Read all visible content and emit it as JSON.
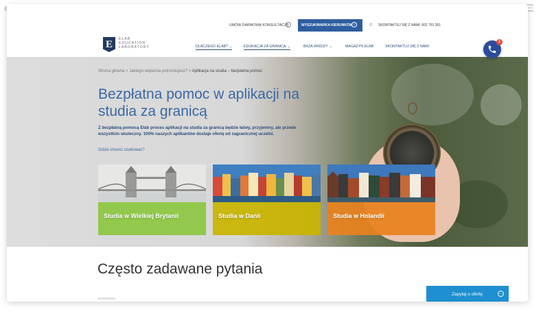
{
  "topbar": {
    "consult": "Umów darmową konsultację",
    "consult_icon": "chevron-right-circle-icon",
    "search_button": "Wyszukiwarka kierunków",
    "phone_label": "Skontaktuj się z nami: 602 751 351"
  },
  "logo": {
    "mark": "E",
    "line1": "ELAB",
    "line2": "EDUCATION",
    "line3": "LABORATORY"
  },
  "nav": {
    "why": "Dlaczego Elab?",
    "edu": "Edukacja za granicą",
    "knowledge": "Baza wiedzy",
    "magazine": "Magazyn Elab",
    "contact": "Skontaktuj się z nami",
    "chevron": "⌄"
  },
  "fab": {
    "badge": "1"
  },
  "breadcrumb": {
    "home": "Strona główna",
    "sep": ">",
    "parent": "Jakiego wsparcia potrzebujesz?",
    "current": "Aplikacja na studia – bezpłatna pomoc"
  },
  "hero": {
    "title": "Bezpłatna pomoc w aplikacji na studia za granicą",
    "description": "Z bezpłatną pomocą Elab proces aplikacji na studia za granicą będzie łatwy, przyjemny, ale przede wszystkim skuteczny. 100% naszych aplikantów dostaje ofertę od zagranicznej uczelni.",
    "question": "Gdzie chcesz studiować?"
  },
  "cards": [
    {
      "label": "Studia w Wielkiej Brytanii",
      "color": "#8cc63f"
    },
    {
      "label": "Studia w Danii",
      "color": "#c8b400"
    },
    {
      "label": "Studia w Holandii",
      "color": "#e8821e"
    }
  ],
  "faq": {
    "title": "Często zadawane pytania",
    "ask_button": "Zapytaj o ofertę"
  },
  "colors": {
    "primary": "#2e5ea0",
    "title_blue": "#3b68a3",
    "ask_button": "#1e8fd0"
  }
}
